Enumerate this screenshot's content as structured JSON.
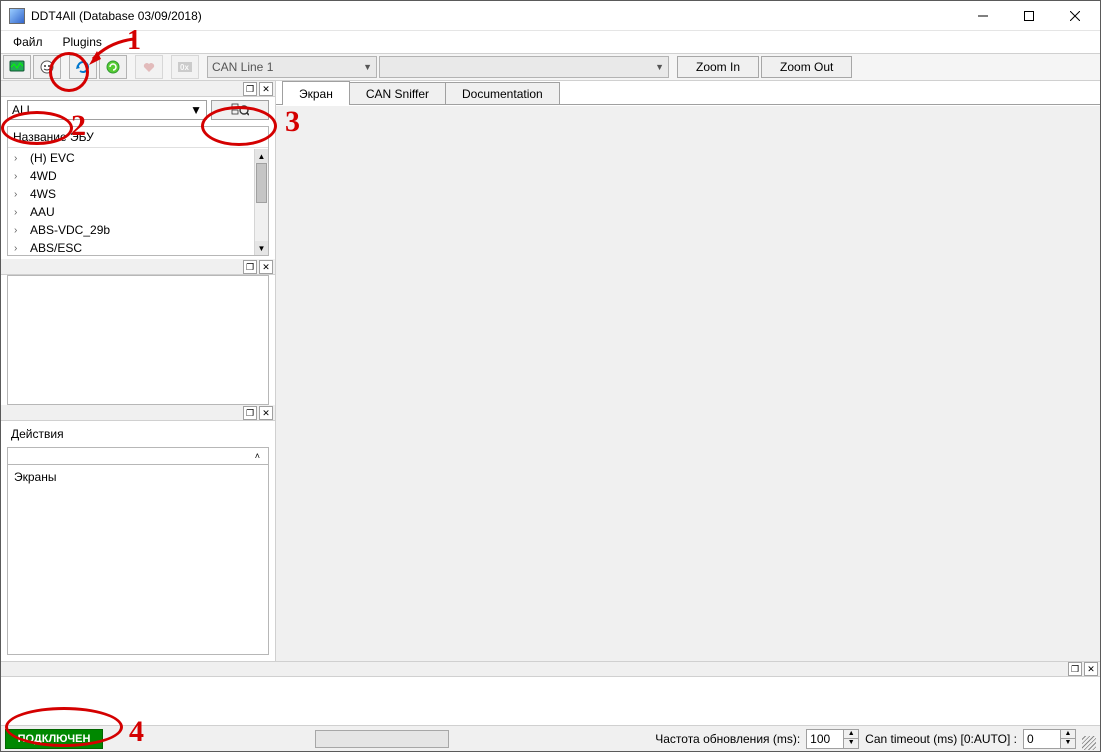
{
  "title": "DDT4All (Database 03/09/2018)",
  "menu": {
    "file": "Файл",
    "plugins": "Plugins"
  },
  "toolbar": {
    "can_line": "CAN Line 1",
    "zoom_in": "Zoom In",
    "zoom_out": "Zoom Out"
  },
  "filter": {
    "selected": "ALL"
  },
  "ecu": {
    "header": "Название ЭБУ",
    "items": [
      "(H) EVC",
      "4WD",
      "4WS",
      "AAU",
      "ABS-VDC_29b",
      "ABS/ESC"
    ]
  },
  "actions": {
    "header": "Действия",
    "screens": "Экраны"
  },
  "tabs": {
    "screen": "Экран",
    "sniffer": "CAN Sniffer",
    "doc": "Documentation"
  },
  "status": {
    "connected": "ПОДКЛЮЧЕН",
    "refresh_label": "Частота обновления (ms):",
    "refresh_value": "100",
    "timeout_label": "Can timeout (ms) [0:AUTO] :",
    "timeout_value": "0"
  },
  "annotations": {
    "n1": "1",
    "n2": "2",
    "n3": "3",
    "n4": "4"
  }
}
